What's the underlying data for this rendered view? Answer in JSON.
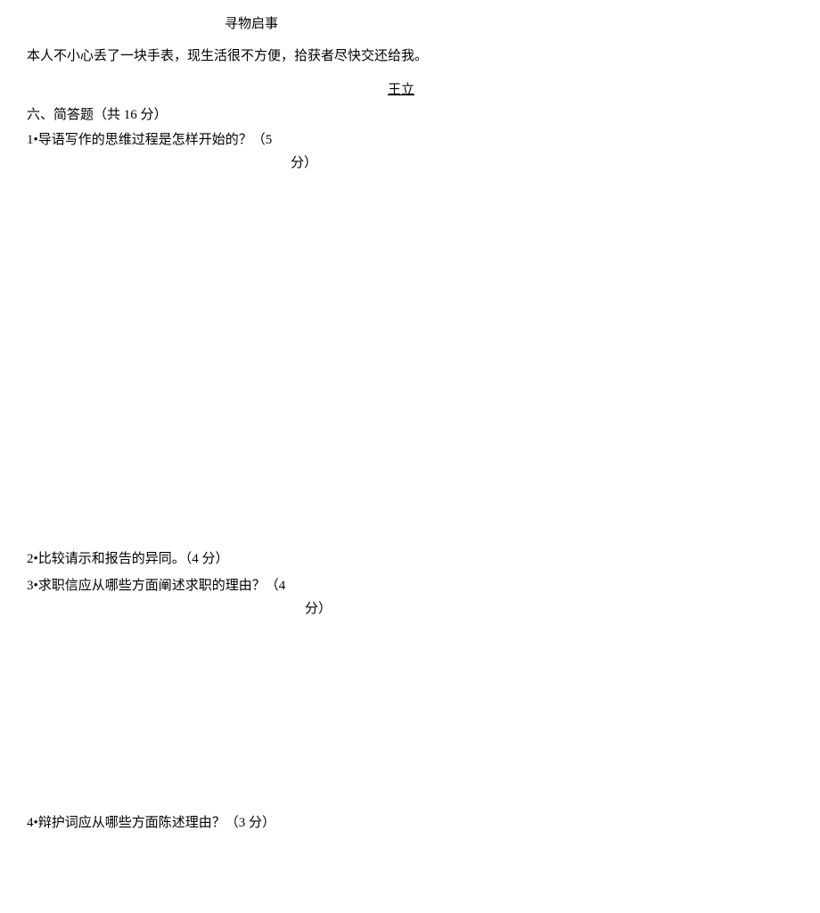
{
  "notice": {
    "title": "寻物启事",
    "body": "本人不小心丢了一块手表，现生活很不方便，拾获者尽快交还给我。",
    "signature": "王立"
  },
  "section6": {
    "heading": "六、简答题（共 16 分）",
    "q1": {
      "line1": "1•导语写作的思维过程是怎样开始的？（5",
      "line2": "分）"
    },
    "q2": "2•比较请示和报告的异同。（4 分）",
    "q3": {
      "line1": "3•求职信应从哪些方面阐述求职的理由？（4",
      "line2": "分）"
    },
    "q4": "4•辩护词应从哪些方面陈述理由？（3 分）"
  }
}
